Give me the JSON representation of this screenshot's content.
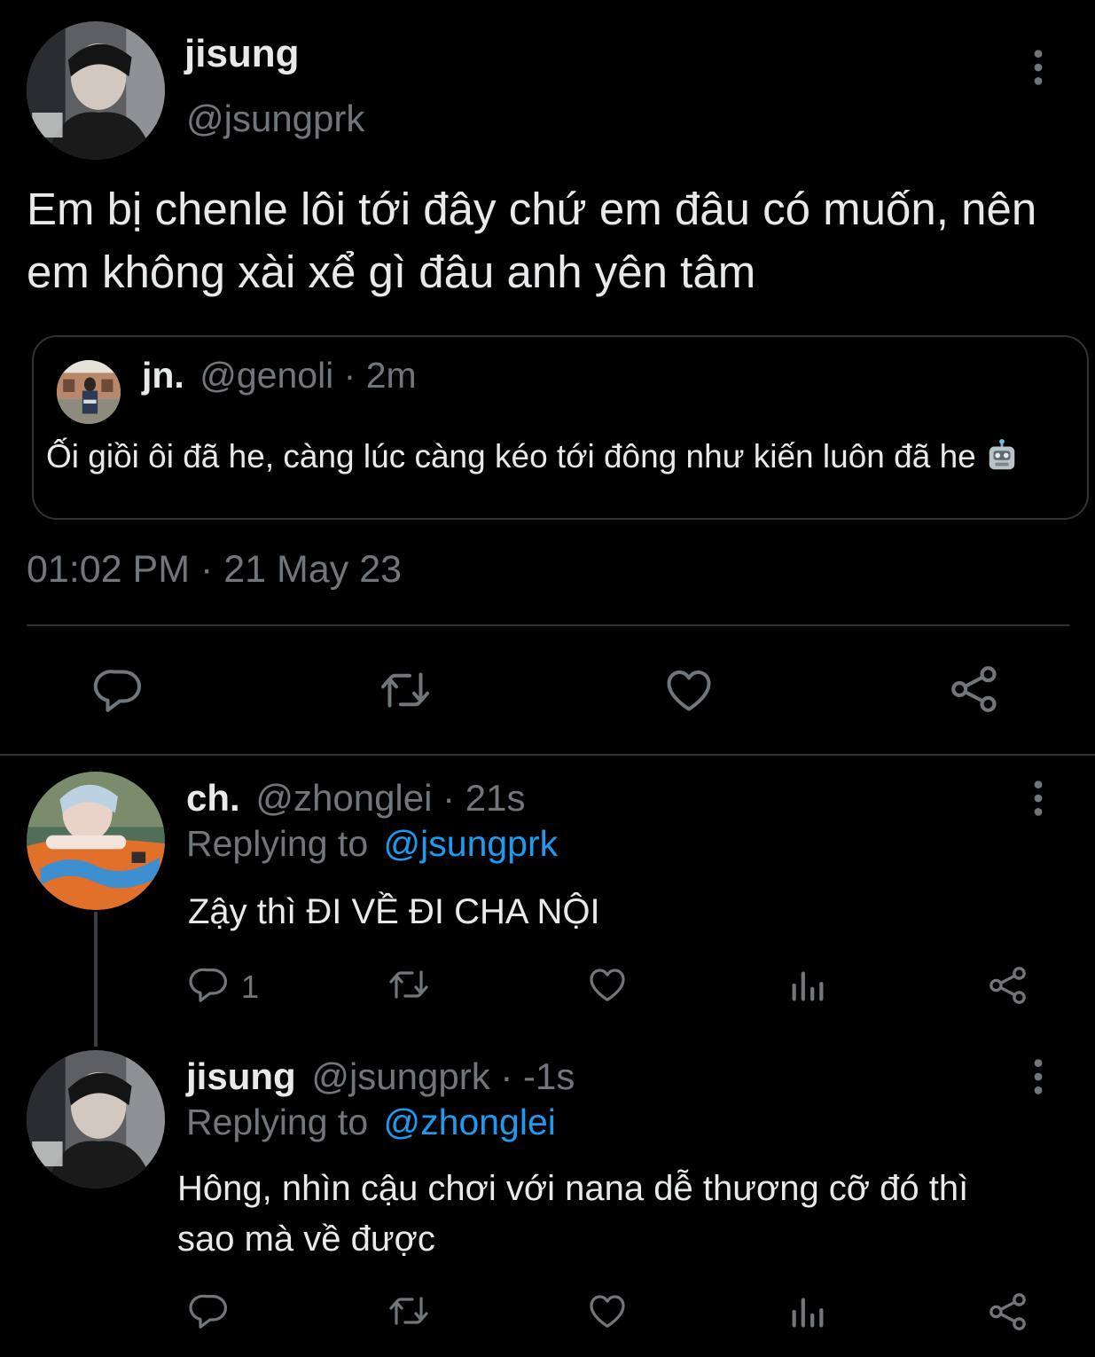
{
  "main_tweet": {
    "name": "jisung",
    "handle": "@jsungprk",
    "text": "Em bị chenle lôi tới đây chứ em đâu có muốn, nên em không xài xể gì đâu anh yên tâm",
    "more_icon": "more-vertical-icon",
    "quote": {
      "name": "jn.",
      "handle_time": "@genoli · 2m",
      "text": "Ối giồi ôi đã he, càng lúc càng kéo tới đông như kiến luôn đã he",
      "emoji": "robot-face-emoji"
    },
    "timestamp": "01:02 PM · 21 May 23",
    "actions": [
      "reply-icon",
      "retweet-icon",
      "like-icon",
      "share-icon"
    ]
  },
  "replies": [
    {
      "name": "ch.",
      "handle_time": "@zhonglei · 21s",
      "replying_label": "Replying to",
      "replying_handle": "@jsungprk",
      "text": "Zậy thì ĐI VỀ ĐI CHA NỘI",
      "reply_count": "1",
      "actions": [
        "reply-icon",
        "retweet-icon",
        "like-icon",
        "analytics-icon",
        "share-icon"
      ]
    },
    {
      "name": "jisung",
      "handle_time": "@jsungprk · -1s",
      "replying_label": "Replying to",
      "replying_handle": "@zhonglei",
      "text": "Hông, nhìn cậu chơi với nana dễ thương cỡ đó thì sao mà về được",
      "actions": [
        "reply-icon",
        "retweet-icon",
        "like-icon",
        "analytics-icon",
        "share-icon"
      ]
    }
  ],
  "colors": {
    "background": "#000000",
    "text": "#e7e9ea",
    "muted": "#71767b",
    "link": "#1d9bf0",
    "border": "#2f3336"
  }
}
